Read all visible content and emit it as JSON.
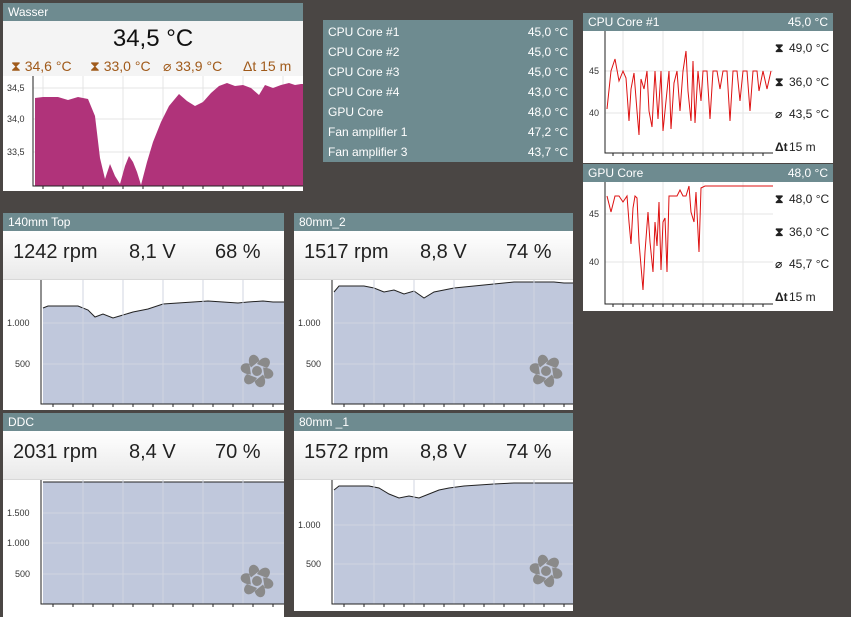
{
  "wasser": {
    "title": "Wasser",
    "value": "34,5 °C",
    "max": "34,6 °C",
    "min": "33,0 °C",
    "avg": "33,9 °C",
    "period": "15 m",
    "yticks": [
      "34,5",
      "34,0",
      "33,5"
    ],
    "color": "#b0337a"
  },
  "sensors": [
    {
      "label": "CPU Core #1",
      "value": "45,0 °C"
    },
    {
      "label": "CPU Core #2",
      "value": "45,0 °C"
    },
    {
      "label": "CPU Core #3",
      "value": "45,0 °C"
    },
    {
      "label": "CPU Core #4",
      "value": "43,0 °C"
    },
    {
      "label": "GPU Core",
      "value": "48,0 °C"
    },
    {
      "label": "Fan amplifier 1",
      "value": "47,2 °C"
    },
    {
      "label": "Fan amplifier 3",
      "value": "43,7 °C"
    }
  ],
  "cpu": {
    "title": "CPU Core #1",
    "value": "45,0 °C",
    "max": "49,0 °C",
    "min": "36,0 °C",
    "avg": "43,5 °C",
    "period": "15 m",
    "yticks": [
      "45",
      "40"
    ],
    "color": "#dd1111"
  },
  "gpu": {
    "title": "GPU Core",
    "value": "48,0 °C",
    "max": "48,0 °C",
    "min": "36,0 °C",
    "avg": "45,7 °C",
    "period": "15 m",
    "yticks": [
      "45",
      "40"
    ],
    "color": "#dd1111"
  },
  "fans": [
    {
      "title": "140mm Top",
      "rpm": "1242 rpm",
      "volt": "8,1 V",
      "pct": "68 %",
      "yticks": [
        "1.000",
        "500"
      ]
    },
    {
      "title": "80mm_2",
      "rpm": "1517 rpm",
      "volt": "8,8 V",
      "pct": "74 %",
      "yticks": [
        "1.000",
        "500"
      ]
    },
    {
      "title": "DDC",
      "rpm": "2031 rpm",
      "volt": "8,4 V",
      "pct": "70 %",
      "yticks": [
        "1.500",
        "1.000",
        "500"
      ]
    },
    {
      "title": "80mm _1",
      "rpm": "1572 rpm",
      "volt": "8,8 V",
      "pct": "74 %",
      "yticks": [
        "1.000",
        "500"
      ]
    }
  ],
  "colors": {
    "titlebar": "#6e8b90",
    "fan_area": "#c0c8dc",
    "fan_icon": "#8a8a8a"
  }
}
